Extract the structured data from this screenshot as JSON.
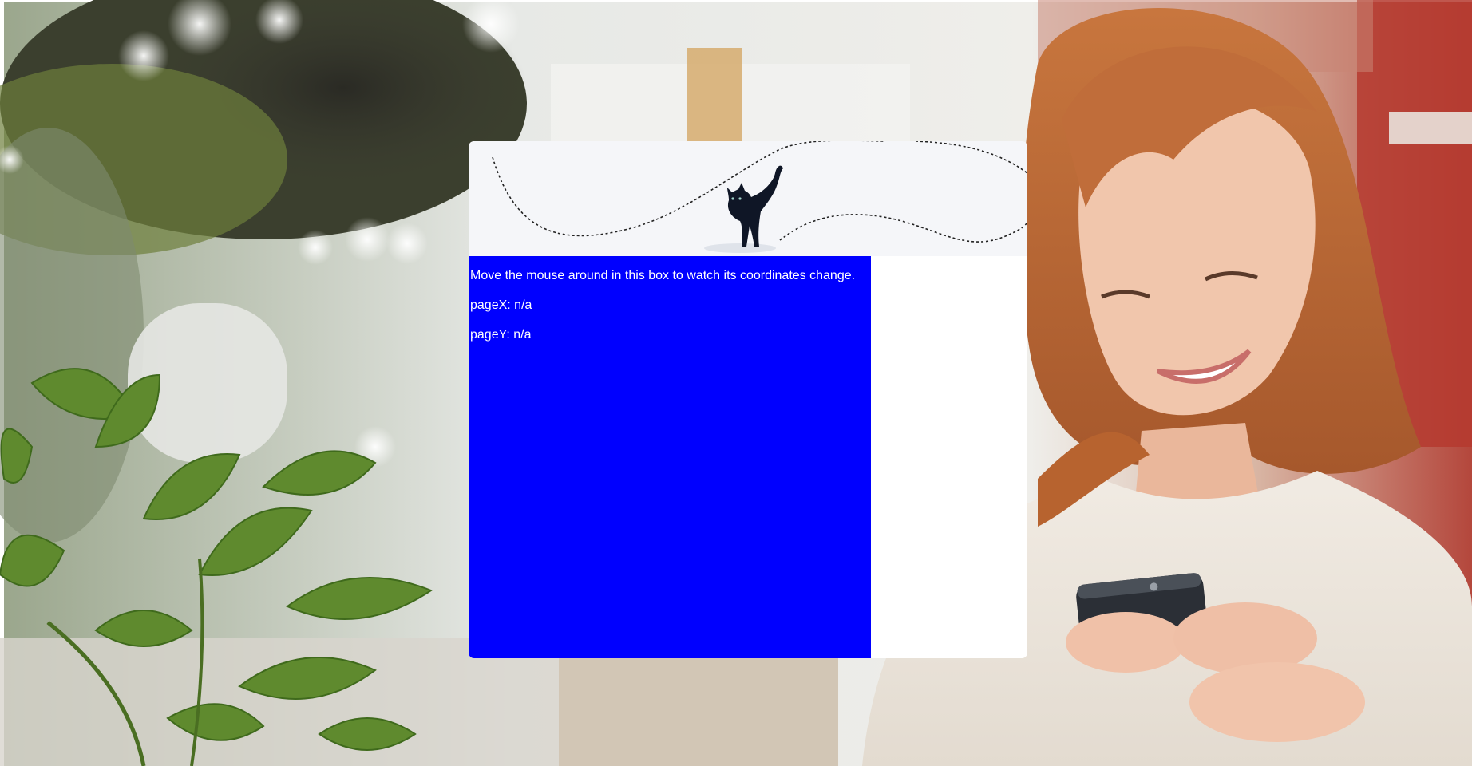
{
  "colors": {
    "box_background": "#0000ff",
    "box_text": "#ffffff",
    "panel_background": "#ffffff",
    "header_background": "#f5f6f9",
    "cat": "#0f1626"
  },
  "background": {
    "icon": "cafe-photo-woman-with-phone"
  },
  "header": {
    "icon": "black-cat-icon"
  },
  "tracker": {
    "instructions": "Move the mouse around in this box to watch its coordinates change.",
    "pagex_label": "pageX:",
    "pagex_value": "n/a",
    "pagey_label": "pageY:",
    "pagey_value": "n/a"
  }
}
